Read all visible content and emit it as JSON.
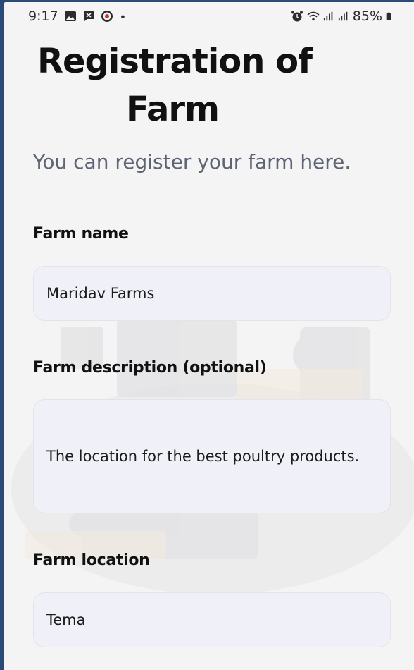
{
  "status_bar": {
    "time": "9:17",
    "battery": "85%",
    "icons_left": [
      "image-icon",
      "message-icon",
      "app-icon",
      "dot-icon"
    ],
    "icons_right": [
      "alarm-icon",
      "wifi-icon",
      "signal-icon",
      "signal-icon",
      "battery-icon"
    ]
  },
  "page": {
    "title_line1": "Registration of",
    "title_line2": "Farm",
    "subtitle": "You can register your farm here."
  },
  "form": {
    "farm_name": {
      "label": "Farm name",
      "value": "Maridav Farms"
    },
    "farm_description": {
      "label": "Farm description (optional)",
      "value": "The location for the best poultry products."
    },
    "farm_location": {
      "label": "Farm location",
      "value": "Tema"
    }
  },
  "colors": {
    "background": "#f4f4f5",
    "field_background": "#f0f0f9",
    "subtitle": "#5e6474",
    "outer_border": "#2b4a7a"
  }
}
